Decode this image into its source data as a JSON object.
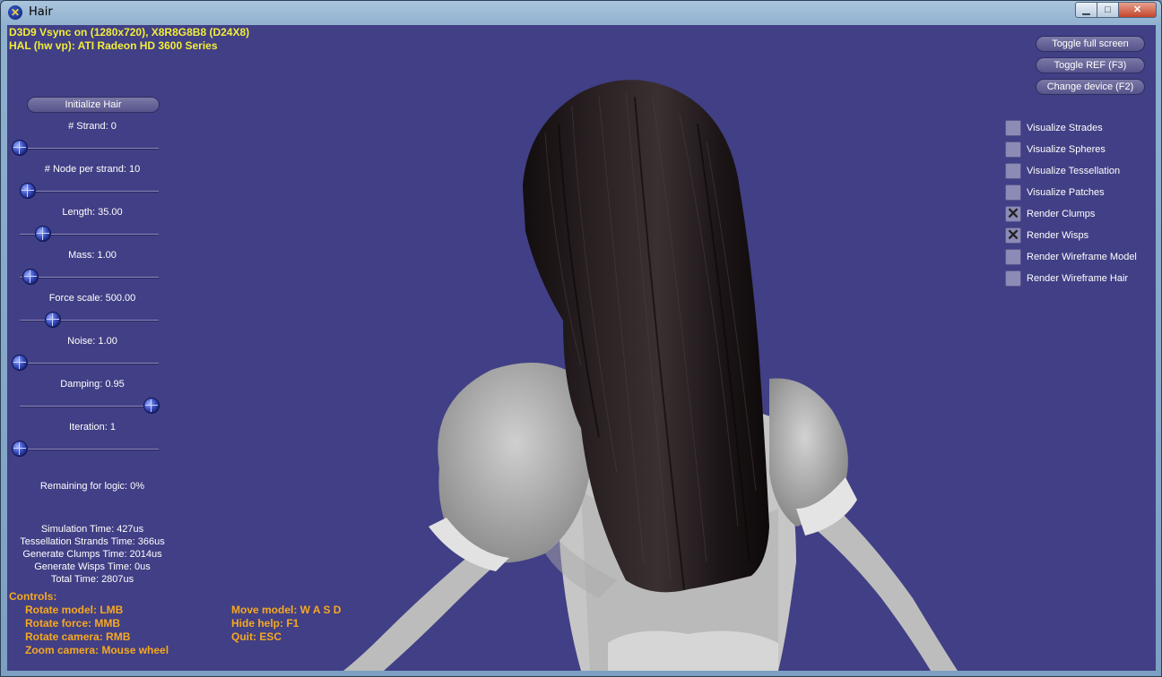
{
  "window": {
    "title": "Hair",
    "icon": "directx-icon"
  },
  "device_info": {
    "line1": "D3D9 Vsync on (1280x720), X8R8G8B8 (D24X8)",
    "line2": "HAL (hw vp): ATI Radeon HD 3600 Series"
  },
  "hud_buttons": {
    "toggle_full_screen": "Toggle full screen",
    "toggle_ref": "Toggle REF (F3)",
    "change_device": "Change device (F2)"
  },
  "init_button": "Initialize Hair",
  "sliders": [
    {
      "label": "# Strand: 0",
      "level": 0.0
    },
    {
      "label": "# Node per strand: 10",
      "level": 0.06
    },
    {
      "label": "Length: 35.00",
      "level": 0.17
    },
    {
      "label": "Mass: 1.00",
      "level": 0.08
    },
    {
      "label": "Force scale: 500.00",
      "level": 0.24
    },
    {
      "label": "Noise: 1.00",
      "level": 0.0
    },
    {
      "label": "Damping: 0.95",
      "level": 0.95
    },
    {
      "label": "Iteration: 1",
      "level": 0.0
    }
  ],
  "remaining": "Remaining for logic: 0%",
  "stats": [
    "Simulation Time: 427us",
    "Tessellation Strands Time: 366us",
    "Generate Clumps Time: 2014us",
    "Generate Wisps Time: 0us",
    "Total Time: 2807us"
  ],
  "checkboxes": [
    {
      "label": "Visualize Strades",
      "checked": false
    },
    {
      "label": "Visualize Spheres",
      "checked": false
    },
    {
      "label": "Visualize Tessellation",
      "checked": false
    },
    {
      "label": "Visualize Patches",
      "checked": false
    },
    {
      "label": "Render Clumps",
      "checked": true
    },
    {
      "label": "Render Wisps",
      "checked": true
    },
    {
      "label": "Render Wireframe Model",
      "checked": false
    },
    {
      "label": "Render Wireframe Hair",
      "checked": false
    }
  ],
  "controls": {
    "heading": "Controls:",
    "left": [
      "Rotate model: LMB",
      "Rotate force: MMB",
      "Rotate camera: RMB",
      "Zoom camera: Mouse wheel"
    ],
    "right": [
      "Move model: W A S D",
      "Hide help: F1",
      "Quit: ESC"
    ]
  },
  "colors": {
    "viewport_bg": "#413f85",
    "info_text": "#f2ee38",
    "controls_text": "#f6a821",
    "hair": "#1e1719",
    "skin": "#b3b3b3"
  }
}
